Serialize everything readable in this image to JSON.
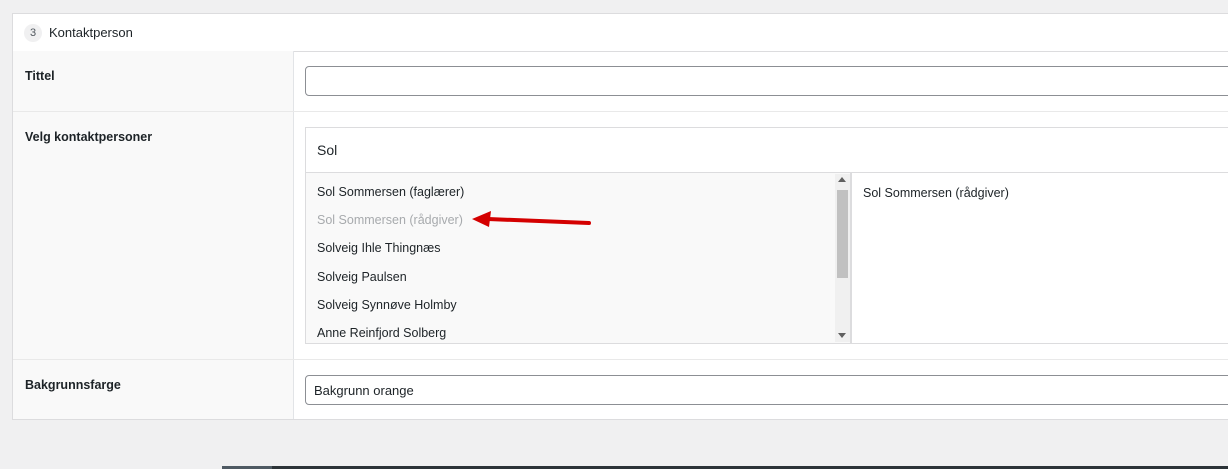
{
  "section": {
    "step_number": "3",
    "title": "Kontaktperson"
  },
  "fields": {
    "title_label": "Tittel",
    "title_value": "",
    "contacts_label": "Velg kontaktpersoner",
    "search_value": "Sol",
    "choices": [
      {
        "label": "Sol Sommersen (faglærer)",
        "disabled": false
      },
      {
        "label": "Sol Sommersen (rådgiver)",
        "disabled": true
      },
      {
        "label": "Solveig Ihle Thingnæs",
        "disabled": false
      },
      {
        "label": "Solveig Paulsen",
        "disabled": false
      },
      {
        "label": "Solveig Synnøve Holmby",
        "disabled": false
      },
      {
        "label": "Anne Reinfjord Solberg",
        "disabled": false
      }
    ],
    "selected": [
      {
        "label": "Sol Sommersen (rådgiver)"
      }
    ],
    "background_label": "Bakgrunnsfarge",
    "background_value": "Bakgrunn orange"
  },
  "annotation": {
    "arrow_color": "#d40000"
  }
}
